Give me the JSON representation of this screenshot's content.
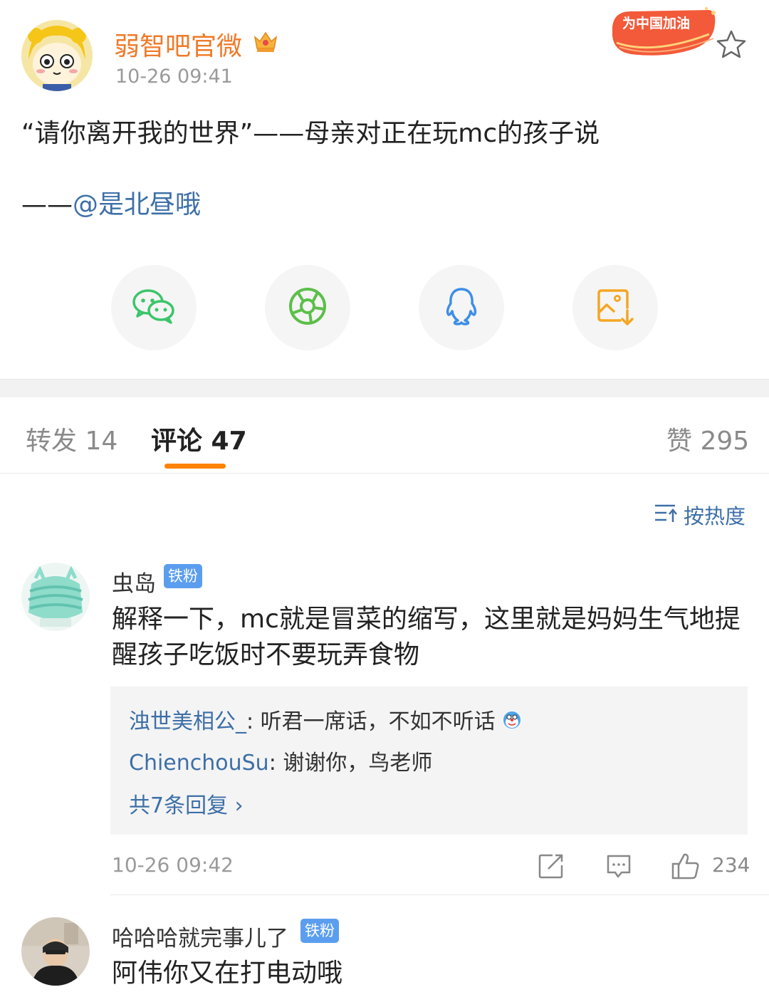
{
  "post": {
    "author": "弱智吧官微",
    "time": "10-26 09:41",
    "cheer_badge": "为中国加油",
    "text": "“请你离开我的世界”——母亲对正在玩mc的孩子说",
    "credit_prefix": "——",
    "credit_mention": "@是北昼哦"
  },
  "share": {
    "items": [
      "wechat-icon",
      "moments-icon",
      "qq-icon",
      "save-image-icon"
    ]
  },
  "tabs": {
    "repost": "转发 14",
    "comments": "评论 47",
    "likes": "赞 295"
  },
  "sort_label": "按热度",
  "comments": [
    {
      "name": "虫岛",
      "badge": "铁粉",
      "text": "解释一下，mc就是冒菜的缩写，这里就是妈妈生气地提醒孩子吃饭时不要玩弄食物",
      "replies": [
        {
          "user": "浊世美相公_",
          "text": ": 听君一席话，不如不听话"
        },
        {
          "user": "ChienchouSu",
          "text": ": 谢谢你，鸟老师"
        }
      ],
      "more_replies": "共7条回复 ›",
      "time": "10-26 09:42",
      "likes": "234"
    },
    {
      "name": "哈哈哈就完事儿了",
      "badge": "铁粉",
      "text": "阿伟你又在打电动哦"
    }
  ],
  "colors": {
    "author": "#f07a2a",
    "link": "#3d6fa8",
    "accent": "#ff8200",
    "badge": "#5b9ef0"
  }
}
